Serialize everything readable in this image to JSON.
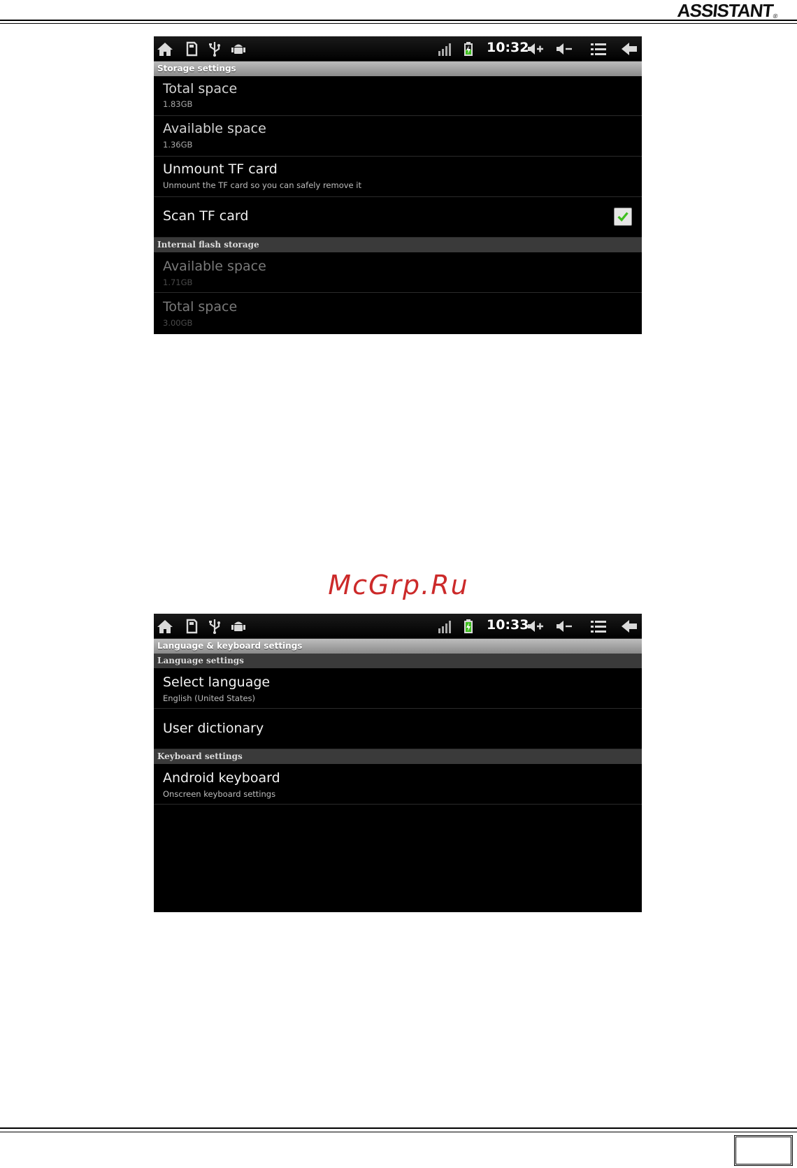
{
  "page": {
    "brand": "ASSISTANT",
    "brand_mark": "®",
    "watermark": "McGrp.Ru"
  },
  "storage_screen": {
    "status": {
      "time": "10:32",
      "icons": [
        "home-icon",
        "sd-card-icon",
        "usb-icon",
        "android-debug-icon",
        "signal-icon",
        "battery-charging-icon",
        "volume-up-icon",
        "volume-down-icon",
        "menu-icon",
        "back-icon"
      ]
    },
    "title": "Storage settings",
    "items": [
      {
        "title": "Total space",
        "subtitle": "1.83GB"
      },
      {
        "title": "Available space",
        "subtitle": "1.36GB"
      },
      {
        "title": "Unmount TF card",
        "subtitle": "Unmount the TF card so you can safely remove it"
      },
      {
        "title": "Scan TF card",
        "checked": true
      }
    ],
    "section_internal": "Internal flash storage",
    "internal_items": [
      {
        "title": "Available space",
        "subtitle": "1.71GB"
      },
      {
        "title": "Total space",
        "subtitle": "3.00GB"
      }
    ]
  },
  "language_screen": {
    "status": {
      "time": "10:33"
    },
    "title": "Language & keyboard settings",
    "section_language": "Language settings",
    "language_items": [
      {
        "title": "Select language",
        "subtitle": "English (United States)"
      },
      {
        "title": "User dictionary"
      }
    ],
    "section_keyboard": "Keyboard settings",
    "keyboard_items": [
      {
        "title": "Android keyboard",
        "subtitle": "Onscreen keyboard settings"
      }
    ]
  },
  "colors": {
    "accent_check": "#3fbf1f",
    "watermark": "#cc2a2a"
  }
}
